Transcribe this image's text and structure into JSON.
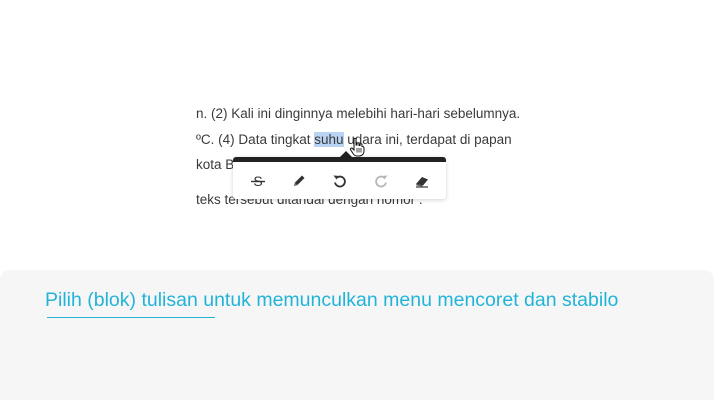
{
  "passage": {
    "line1": "n. (2) Kali ini dinginnya melebihi hari-hari sebelumnya.",
    "line2_before": "ºC. (4) Data tingkat ",
    "line2_selected": "suhu",
    "line2_after": " udara ini, terdapat di papan",
    "line3": "kota Bo",
    "line4": "teks tersebut ditandai dengan nomor ."
  },
  "toolbar": {
    "tools": [
      "strikethrough-icon",
      "pencil-icon",
      "undo-icon",
      "redo-icon",
      "eraser-icon"
    ],
    "redo_enabled": false
  },
  "hint": {
    "text": "Pilih (blok) tulisan untuk memunculkan menu mencoret dan stabilo"
  },
  "colors": {
    "accent": "#22b4d8",
    "selection": "#b9d3f3",
    "toolbar_border": "#222222",
    "panel_bg": "#f6f6f6"
  }
}
